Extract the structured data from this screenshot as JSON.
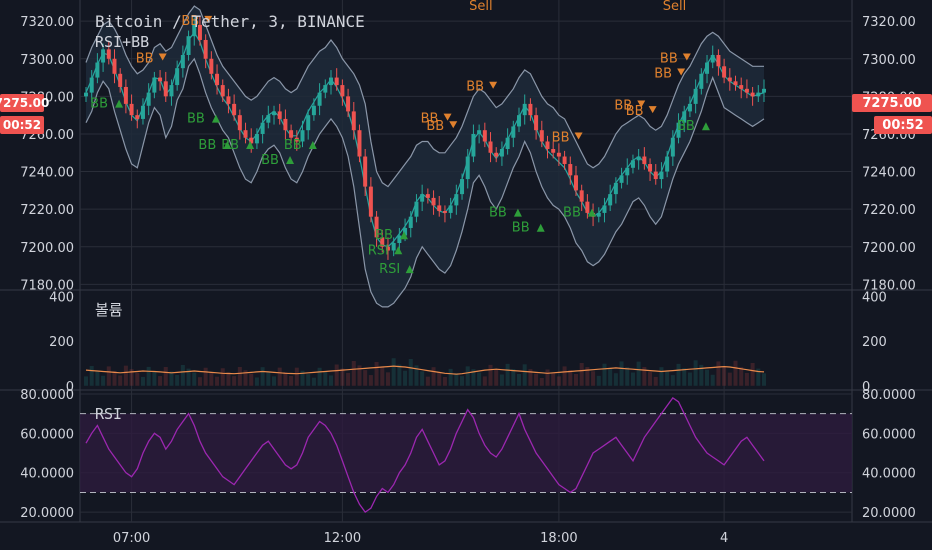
{
  "header": {
    "symbol": "Bitcoin / Tether, 3, BINANCE",
    "indicator": "RSI+BB"
  },
  "price_badge": {
    "value": "7275.00",
    "timer": "00:52"
  },
  "panes": {
    "volume_label": "볼륨",
    "rsi_label": "RSI"
  },
  "colors": {
    "background": "#131722",
    "grid": "#2a2e39",
    "candle_up": "#26a69a",
    "candle_down": "#ef5350",
    "bb_fill": "#1e2a3a",
    "bb_band": "#8a96a8",
    "bb_basis": "#26a6a0",
    "sell_text": "#e0812e",
    "buy_text": "#2e9e3a",
    "volume_ma": "#e8894a",
    "rsi_line": "#9c27b0",
    "rsi_band": "#2d1b3d",
    "badge_bg": "#ef5350"
  },
  "chart_data": [
    {
      "type": "line",
      "pane": "price",
      "title": "Bitcoin / Tether, 3, BINANCE",
      "x_ticks": [
        "07:00",
        "12:00",
        "18:00",
        "4"
      ],
      "y_ticks": [
        "7180.00",
        "7200.00",
        "7220.00",
        "7240.00",
        "7260.00",
        "7280.00",
        "7300.00",
        "7320.00"
      ],
      "ylim": [
        7177,
        7327
      ],
      "series": [
        {
          "key": "close",
          "values": [
            7282,
            7290,
            7298,
            7305,
            7300,
            7292,
            7285,
            7276,
            7270,
            7268,
            7275,
            7282,
            7290,
            7288,
            7280,
            7286,
            7295,
            7302,
            7312,
            7318,
            7310,
            7300,
            7292,
            7286,
            7280,
            7276,
            7270,
            7262,
            7258,
            7255,
            7260,
            7266,
            7270,
            7272,
            7268,
            7262,
            7258,
            7256,
            7262,
            7270,
            7275,
            7282,
            7286,
            7290,
            7286,
            7280,
            7272,
            7262,
            7248,
            7232,
            7216,
            7205,
            7200,
            7198,
            7202,
            7206,
            7210,
            7216,
            7224,
            7228,
            7226,
            7222,
            7219,
            7218,
            7222,
            7228,
            7236,
            7248,
            7260,
            7262,
            7256,
            7250,
            7248,
            7252,
            7258,
            7264,
            7270,
            7276,
            7270,
            7262,
            7256,
            7252,
            7250,
            7248,
            7244,
            7238,
            7230,
            7224,
            7218,
            7216,
            7218,
            7222,
            7228,
            7234,
            7238,
            7242,
            7246,
            7248,
            7244,
            7240,
            7236,
            7240,
            7248,
            7258,
            7266,
            7272,
            7276,
            7284,
            7292,
            7298,
            7302,
            7296,
            7290,
            7288,
            7286,
            7284,
            7282,
            7280,
            7282,
            7284
          ]
        },
        {
          "key": "bb_upper",
          "values": [
            7298,
            7306,
            7312,
            7318,
            7320,
            7316,
            7310,
            7302,
            7296,
            7292,
            7294,
            7298,
            7306,
            7308,
            7304,
            7306,
            7312,
            7318,
            7324,
            7328,
            7326,
            7318,
            7310,
            7302,
            7296,
            7292,
            7288,
            7284,
            7280,
            7278,
            7280,
            7284,
            7288,
            7290,
            7288,
            7284,
            7282,
            7284,
            7290,
            7296,
            7300,
            7304,
            7306,
            7310,
            7306,
            7300,
            7296,
            7292,
            7286,
            7276,
            7256,
            7240,
            7234,
            7232,
            7236,
            7240,
            7244,
            7248,
            7254,
            7256,
            7256,
            7252,
            7250,
            7250,
            7254,
            7258,
            7264,
            7272,
            7280,
            7284,
            7282,
            7278,
            7274,
            7276,
            7280,
            7284,
            7290,
            7294,
            7292,
            7286,
            7280,
            7276,
            7274,
            7270,
            7268,
            7262,
            7256,
            7250,
            7244,
            7242,
            7244,
            7248,
            7254,
            7260,
            7264,
            7266,
            7268,
            7270,
            7268,
            7264,
            7262,
            7264,
            7270,
            7278,
            7286,
            7292,
            7296,
            7302,
            7308,
            7312,
            7314,
            7312,
            7308,
            7304,
            7302,
            7300,
            7298,
            7296,
            7296,
            7296
          ]
        },
        {
          "key": "bb_lower",
          "values": [
            7266,
            7272,
            7282,
            7288,
            7284,
            7272,
            7262,
            7252,
            7244,
            7242,
            7254,
            7266,
            7274,
            7270,
            7258,
            7264,
            7278,
            7284,
            7296,
            7300,
            7292,
            7282,
            7274,
            7268,
            7262,
            7258,
            7250,
            7242,
            7236,
            7234,
            7240,
            7248,
            7252,
            7254,
            7250,
            7242,
            7236,
            7234,
            7240,
            7248,
            7254,
            7260,
            7264,
            7268,
            7264,
            7258,
            7248,
            7232,
            7210,
            7188,
            7176,
            7170,
            7168,
            7168,
            7170,
            7174,
            7178,
            7184,
            7194,
            7200,
            7196,
            7192,
            7188,
            7186,
            7190,
            7198,
            7208,
            7220,
            7234,
            7238,
            7232,
            7224,
            7220,
            7226,
            7234,
            7242,
            7248,
            7256,
            7250,
            7240,
            7232,
            7226,
            7222,
            7220,
            7216,
            7210,
            7202,
            7198,
            7192,
            7190,
            7192,
            7196,
            7202,
            7208,
            7212,
            7218,
            7224,
            7226,
            7222,
            7216,
            7212,
            7216,
            7226,
            7236,
            7244,
            7250,
            7256,
            7264,
            7272,
            7282,
            7290,
            7282,
            7274,
            7272,
            7270,
            7268,
            7266,
            7264,
            7266,
            7268
          ]
        }
      ]
    },
    {
      "type": "area",
      "pane": "volume",
      "y_ticks": [
        "0",
        "200",
        "400"
      ],
      "ylim": [
        -10,
        420
      ],
      "series": [
        {
          "key": "volume_ma",
          "values": [
            70,
            68,
            66,
            64,
            62,
            60,
            58,
            60,
            62,
            64,
            66,
            65,
            64,
            62,
            60,
            58,
            60,
            62,
            64,
            66,
            64,
            62,
            60,
            58,
            56,
            55,
            54,
            56,
            58,
            60,
            62,
            64,
            62,
            60,
            58,
            56,
            55,
            54,
            56,
            58,
            60,
            62,
            64,
            66,
            68,
            70,
            72,
            74,
            76,
            78,
            80,
            82,
            84,
            86,
            88,
            86,
            84,
            80,
            76,
            72,
            68,
            64,
            60,
            56,
            54,
            52,
            54,
            58,
            62,
            66,
            70,
            72,
            74,
            72,
            70,
            68,
            66,
            64,
            62,
            60,
            58,
            56,
            58,
            60,
            62,
            64,
            66,
            68,
            70,
            72,
            74,
            76,
            78,
            80,
            78,
            76,
            74,
            72,
            70,
            68,
            66,
            64,
            66,
            68,
            70,
            72,
            74,
            76,
            78,
            80,
            82,
            84,
            86,
            84,
            80,
            76,
            72,
            68,
            64,
            62
          ]
        }
      ]
    },
    {
      "type": "line",
      "pane": "rsi",
      "y_ticks": [
        "20.0000",
        "40.0000",
        "60.0000",
        "80.0000"
      ],
      "ylim": [
        15,
        82
      ],
      "bands": [
        30,
        70
      ],
      "series": [
        {
          "key": "rsi",
          "values": [
            55,
            60,
            64,
            58,
            52,
            48,
            44,
            40,
            38,
            42,
            50,
            56,
            60,
            58,
            52,
            56,
            62,
            66,
            70,
            64,
            56,
            50,
            46,
            42,
            38,
            36,
            34,
            38,
            42,
            46,
            50,
            54,
            56,
            52,
            48,
            44,
            42,
            44,
            50,
            58,
            62,
            66,
            64,
            60,
            54,
            46,
            38,
            30,
            24,
            20,
            22,
            28,
            32,
            30,
            34,
            40,
            44,
            50,
            58,
            62,
            56,
            50,
            44,
            46,
            52,
            60,
            66,
            72,
            68,
            60,
            54,
            50,
            48,
            52,
            58,
            64,
            70,
            62,
            56,
            50,
            46,
            42,
            38,
            34,
            32,
            30,
            32,
            38,
            44,
            50,
            52,
            54,
            56,
            58,
            54,
            50,
            46,
            52,
            58,
            62,
            66,
            70,
            74,
            78,
            76,
            70,
            64,
            58,
            54,
            50,
            48,
            46,
            44,
            48,
            52,
            56,
            58,
            54,
            50,
            46
          ]
        }
      ]
    }
  ],
  "signals": {
    "sell": [
      {
        "label": "Sell",
        "i": 70,
        "v": 7326
      },
      {
        "label": "Sell",
        "i": 104,
        "v": 7326
      },
      {
        "label": "BB",
        "i": 19,
        "v": 7318
      },
      {
        "label": "BB",
        "i": 11,
        "v": 7298
      },
      {
        "label": "BB",
        "i": 69,
        "v": 7283
      },
      {
        "label": "BB",
        "i": 61,
        "v": 7266
      },
      {
        "label": "BB",
        "i": 62,
        "v": 7262
      },
      {
        "label": "BB",
        "i": 84,
        "v": 7256
      },
      {
        "label": "BB",
        "i": 95,
        "v": 7273
      },
      {
        "label": "BB",
        "i": 97,
        "v": 7270
      },
      {
        "label": "BB",
        "i": 103,
        "v": 7298
      },
      {
        "label": "BB",
        "i": 102,
        "v": 7290
      }
    ],
    "buy": [
      {
        "label": "BB",
        "i": 3,
        "v": 7274
      },
      {
        "label": "BB",
        "i": 20,
        "v": 7266
      },
      {
        "label": "BB",
        "i": 22,
        "v": 7252
      },
      {
        "label": "BB",
        "i": 26,
        "v": 7252
      },
      {
        "label": "BB",
        "i": 33,
        "v": 7244
      },
      {
        "label": "BB",
        "i": 37,
        "v": 7252
      },
      {
        "label": "BB",
        "i": 53,
        "v": 7204
      },
      {
        "label": "RSI",
        "i": 52,
        "v": 7196
      },
      {
        "label": "RSI",
        "i": 54,
        "v": 7186
      },
      {
        "label": "BB",
        "i": 73,
        "v": 7216
      },
      {
        "label": "BB",
        "i": 77,
        "v": 7208
      },
      {
        "label": "BB",
        "i": 86,
        "v": 7216
      },
      {
        "label": "BB",
        "i": 106,
        "v": 7262
      }
    ]
  }
}
